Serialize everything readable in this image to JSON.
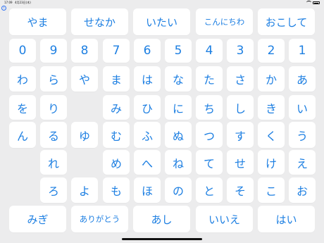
{
  "status_bar": {
    "time": "17:09",
    "date": "4月23日(木)"
  },
  "phrases_top": [
    "やま",
    "せなか",
    "いたい",
    "こんにちわ",
    "おこして"
  ],
  "digits": [
    "0",
    "9",
    "8",
    "7",
    "6",
    "5",
    "4",
    "3",
    "2",
    "1"
  ],
  "kana_rows": [
    [
      "わ",
      "ら",
      "や",
      "ま",
      "は",
      "な",
      "た",
      "さ",
      "か",
      "あ"
    ],
    [
      "を",
      "り",
      "",
      "み",
      "ひ",
      "に",
      "ち",
      "し",
      "き",
      "い"
    ],
    [
      "ん",
      "る",
      "ゆ",
      "む",
      "ふ",
      "ぬ",
      "つ",
      "す",
      "く",
      "う"
    ],
    [
      "",
      "れ",
      "",
      "め",
      "へ",
      "ね",
      "て",
      "せ",
      "け",
      "え"
    ],
    [
      "",
      "ろ",
      "よ",
      "も",
      "ほ",
      "の",
      "と",
      "そ",
      "こ",
      "お"
    ]
  ],
  "phrases_bottom": [
    "みぎ",
    "ありがとう",
    "あし",
    "いいえ",
    "はい"
  ]
}
